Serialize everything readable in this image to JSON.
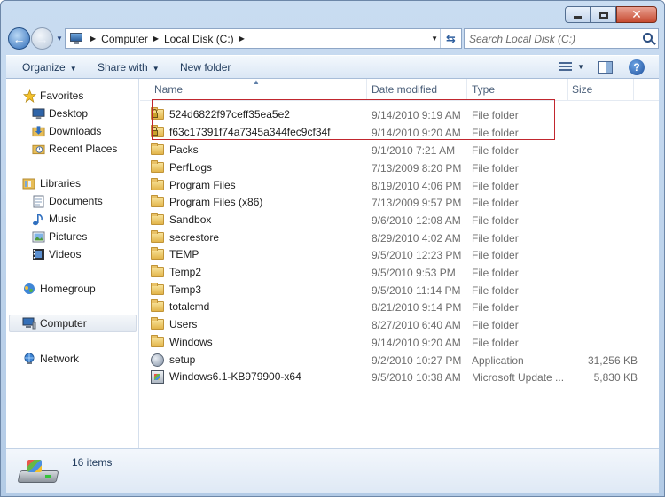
{
  "addressBar": {
    "crumbs": [
      "Computer",
      "Local Disk (C:)"
    ]
  },
  "search": {
    "placeholder": "Search Local Disk (C:)"
  },
  "toolbar": {
    "organize": "Organize",
    "share_with": "Share with",
    "new_folder": "New folder"
  },
  "navPane": {
    "favorites": "Favorites",
    "desktop": "Desktop",
    "downloads": "Downloads",
    "recent_places": "Recent Places",
    "libraries": "Libraries",
    "documents": "Documents",
    "music": "Music",
    "pictures": "Pictures",
    "videos": "Videos",
    "homegroup": "Homegroup",
    "computer": "Computer",
    "network": "Network"
  },
  "columns": {
    "name": "Name",
    "date_modified": "Date modified",
    "type": "Type",
    "size": "Size"
  },
  "files": [
    {
      "name": "524d6822f97ceff35ea5e2",
      "date": "9/14/2010 9:19 AM",
      "type": "File folder",
      "size": "",
      "icon": "locked-folder-icon"
    },
    {
      "name": "f63c17391f74a7345a344fec9cf34f",
      "date": "9/14/2010 9:20 AM",
      "type": "File folder",
      "size": "",
      "icon": "locked-folder-icon"
    },
    {
      "name": "Packs",
      "date": "9/1/2010 7:21 AM",
      "type": "File folder",
      "size": "",
      "icon": "folder-icon"
    },
    {
      "name": "PerfLogs",
      "date": "7/13/2009 8:20 PM",
      "type": "File folder",
      "size": "",
      "icon": "folder-icon"
    },
    {
      "name": "Program Files",
      "date": "8/19/2010 4:06 PM",
      "type": "File folder",
      "size": "",
      "icon": "folder-icon"
    },
    {
      "name": "Program Files (x86)",
      "date": "7/13/2009 9:57 PM",
      "type": "File folder",
      "size": "",
      "icon": "folder-icon"
    },
    {
      "name": "Sandbox",
      "date": "9/6/2010 12:08 AM",
      "type": "File folder",
      "size": "",
      "icon": "folder-icon"
    },
    {
      "name": "secrestore",
      "date": "8/29/2010 4:02 AM",
      "type": "File folder",
      "size": "",
      "icon": "folder-icon"
    },
    {
      "name": "TEMP",
      "date": "9/5/2010 12:23 PM",
      "type": "File folder",
      "size": "",
      "icon": "folder-icon"
    },
    {
      "name": "Temp2",
      "date": "9/5/2010 9:53 PM",
      "type": "File folder",
      "size": "",
      "icon": "folder-icon"
    },
    {
      "name": "Temp3",
      "date": "9/5/2010 11:14 PM",
      "type": "File folder",
      "size": "",
      "icon": "folder-icon"
    },
    {
      "name": "totalcmd",
      "date": "8/21/2010 9:14 PM",
      "type": "File folder",
      "size": "",
      "icon": "folder-icon"
    },
    {
      "name": "Users",
      "date": "8/27/2010 6:40 AM",
      "type": "File folder",
      "size": "",
      "icon": "folder-icon"
    },
    {
      "name": "Windows",
      "date": "9/14/2010 9:20 AM",
      "type": "File folder",
      "size": "",
      "icon": "folder-icon"
    },
    {
      "name": "setup",
      "date": "9/2/2010 10:27 PM",
      "type": "Application",
      "size": "31,256 KB",
      "icon": "setup-icon"
    },
    {
      "name": "Windows6.1-KB979900-x64",
      "date": "9/5/2010 10:38 AM",
      "type": "Microsoft Update ...",
      "size": "5,830 KB",
      "icon": "update-package-icon"
    }
  ],
  "status": {
    "item_count": "16 items"
  },
  "colors": {
    "highlight_border": "#c1262e",
    "window_frame": "#c9dcf1"
  }
}
